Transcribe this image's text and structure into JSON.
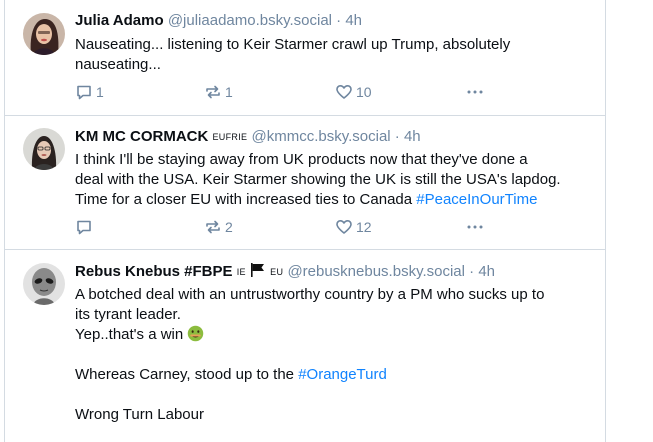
{
  "posts": [
    {
      "name": "Julia Adamo",
      "handle": "@juliaadamo.bsky.social",
      "separator": "·",
      "time": "4h",
      "lines": [
        "Nauseating... listening to Keir Starmer crawl up Trump, absolutely",
        "nauseating..."
      ],
      "replies": "1",
      "reposts": "1",
      "likes": "10"
    },
    {
      "name": "KM MC CORMACK",
      "badge": "EUFRIE",
      "handle": "@kmmcc.bsky.social",
      "separator": "·",
      "time": "4h",
      "lines": [
        "I think I'll be staying away from UK products now that they've done a",
        "deal with the USA. Keir Starmer showing the UK is still the USA's lapdog.",
        "Time for a closer EU with increased ties to Canada "
      ],
      "hashtag": "#PeaceInOurTime",
      "replies": "",
      "reposts": "2",
      "likes": "12"
    },
    {
      "name": "Rebus Knebus #FBPE",
      "badge_ie": "IE",
      "flag_icon": "black-flag-icon",
      "badge_eu": "EU",
      "handle": "@rebusknebus.bsky.social",
      "separator": "·",
      "time": "4h",
      "line1": "A botched deal with an untrustworthy country by a PM who sucks up to",
      "line2": "its tyrant leader.",
      "line3": "Yep..that's a win ",
      "emoji_icon": "nauseated-face-icon",
      "line4": "Whereas Carney, stood up to the ",
      "hashtag": "#OrangeTurd",
      "line5": "Wrong Turn Labour"
    }
  ],
  "colors": {
    "accent": "#1083fe",
    "muted": "#6f869f",
    "border": "#d4dbe2"
  },
  "icons": {
    "reply": "reply-icon",
    "repost": "repost-icon",
    "like": "heart-icon",
    "more": "more-icon"
  }
}
